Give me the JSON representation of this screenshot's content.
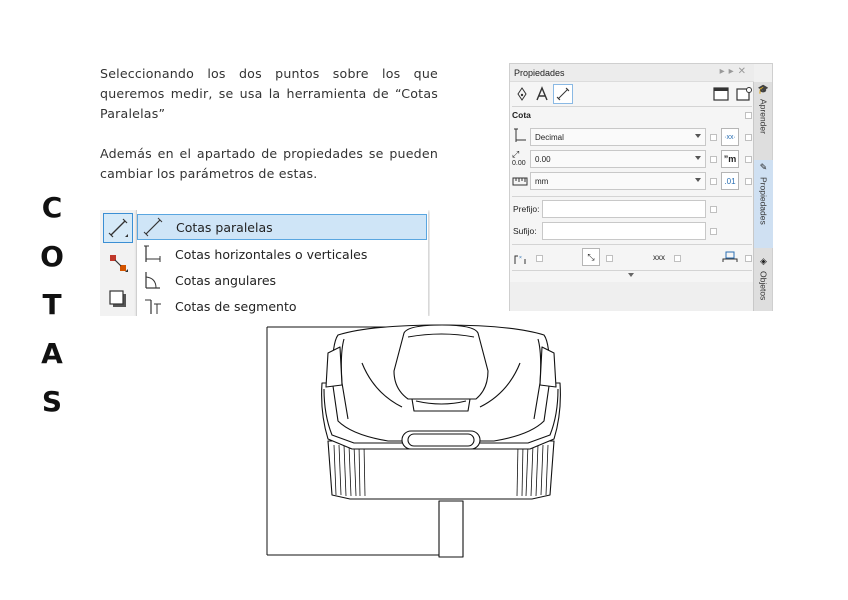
{
  "side_title": [
    "C",
    "O",
    "T",
    "A",
    "S"
  ],
  "paragraphs": {
    "p1": "Seleccionando los dos puntos sobre los que queremos medir, se usa la herramienta de “Cotas Paralelas”",
    "p2": "Además en el apartado de propiedades se pueden cambiar los parámetros de estas."
  },
  "flyout": {
    "items": [
      {
        "label": "Cotas paralelas",
        "icon": "parallel-dimension-icon",
        "selected": true
      },
      {
        "label": "Cotas horizontales o verticales",
        "icon": "horizontal-vertical-dimension-icon"
      },
      {
        "label": "Cotas angulares",
        "icon": "angular-dimension-icon"
      },
      {
        "label": "Cotas de segmento",
        "icon": "segment-dimension-icon"
      }
    ]
  },
  "panel": {
    "title": "Propiedades",
    "section": "Cota",
    "style_value": "Decimal",
    "precision_value": "0.00",
    "precision_icon_label": "0.00",
    "units_value": "mm",
    "prefix_label": "Prefijo:",
    "suffix_label": "Sufijo:",
    "xxx_label": "xxx",
    "tabs": [
      "Aprender",
      "Propiedades",
      "Objetos"
    ],
    "colors": {
      "accent": "#3b8fd4",
      "active_tab": "#cfe0f2"
    }
  }
}
